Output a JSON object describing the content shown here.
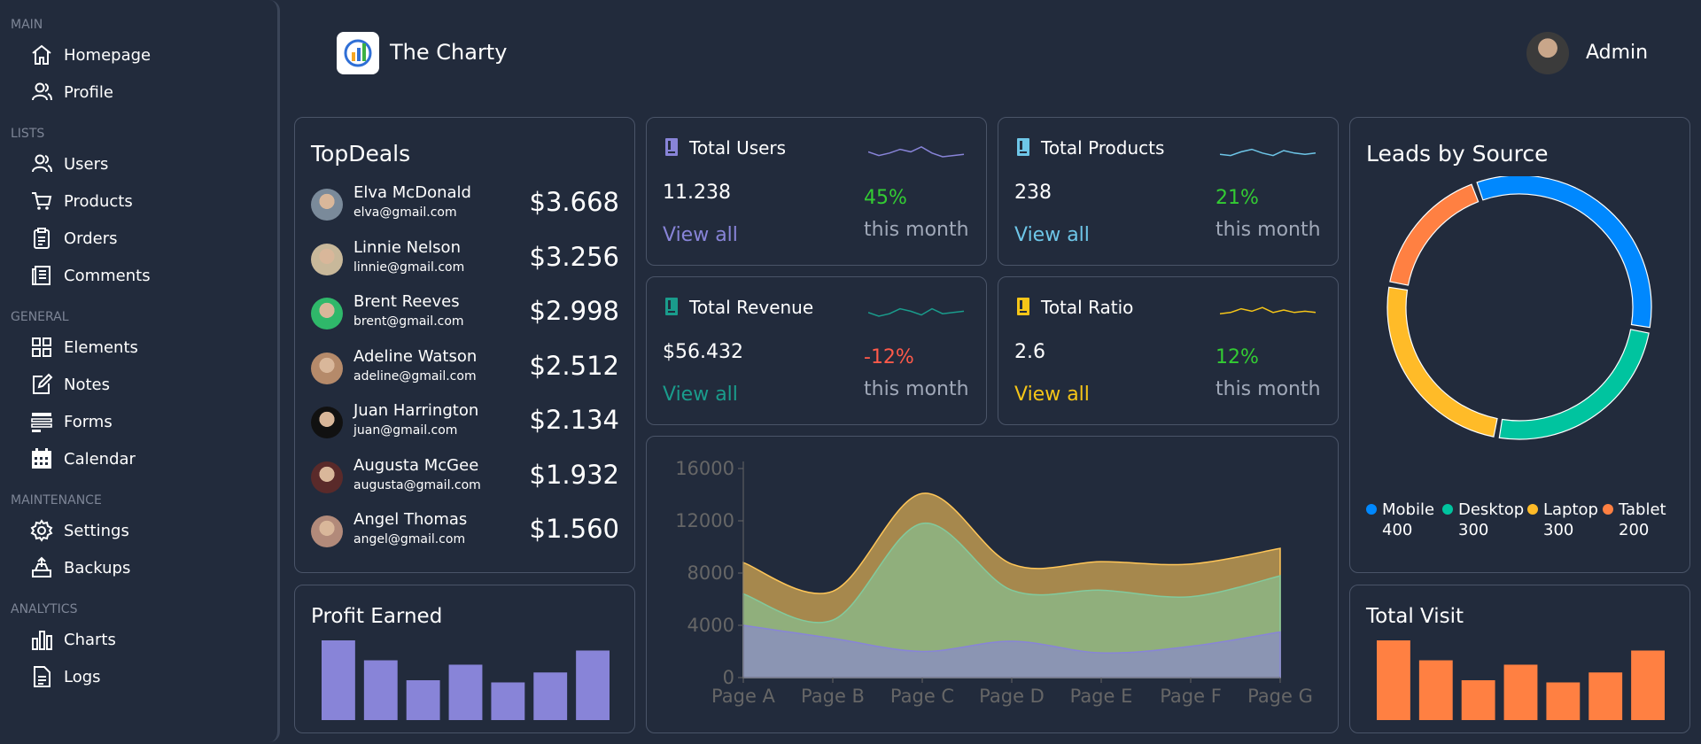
{
  "sidebar": {
    "sections": [
      {
        "title": "MAIN",
        "items": [
          {
            "label": "Homepage",
            "icon": "home-icon"
          },
          {
            "label": "Profile",
            "icon": "user-icon"
          }
        ]
      },
      {
        "title": "LISTS",
        "items": [
          {
            "label": "Users",
            "icon": "users-icon"
          },
          {
            "label": "Products",
            "icon": "cart-icon"
          },
          {
            "label": "Orders",
            "icon": "clipboard-icon"
          },
          {
            "label": "Comments",
            "icon": "comments-icon"
          }
        ]
      },
      {
        "title": "GENERAL",
        "items": [
          {
            "label": "Elements",
            "icon": "grid-icon"
          },
          {
            "label": "Notes",
            "icon": "note-icon"
          },
          {
            "label": "Forms",
            "icon": "form-icon"
          },
          {
            "label": "Calendar",
            "icon": "calendar-icon"
          }
        ]
      },
      {
        "title": "MAINTENANCE",
        "items": [
          {
            "label": "Settings",
            "icon": "gear-icon"
          },
          {
            "label": "Backups",
            "icon": "backup-icon"
          }
        ]
      },
      {
        "title": "ANALYTICS",
        "items": [
          {
            "label": "Charts",
            "icon": "chart-icon"
          },
          {
            "label": "Logs",
            "icon": "log-icon"
          }
        ]
      }
    ]
  },
  "header": {
    "app_title": "The Charty",
    "user_name": "Admin"
  },
  "top_deals": {
    "title": "TopDeals",
    "rows": [
      {
        "name": "Elva McDonald",
        "email": "elva@gmail.com",
        "amount": "$3.668"
      },
      {
        "name": "Linnie Nelson",
        "email": "linnie@gmail.com",
        "amount": "$3.256"
      },
      {
        "name": "Brent Reeves",
        "email": "brent@gmail.com",
        "amount": "$2.998"
      },
      {
        "name": "Adeline Watson",
        "email": "adeline@gmail.com",
        "amount": "$2.512"
      },
      {
        "name": "Juan Harrington",
        "email": "juan@gmail.com",
        "amount": "$2.134"
      },
      {
        "name": "Augusta McGee",
        "email": "augusta@gmail.com",
        "amount": "$1.932"
      },
      {
        "name": "Angel Thomas",
        "email": "angel@gmail.com",
        "amount": "$1.560"
      }
    ]
  },
  "stats": [
    {
      "title": "Total Users",
      "value": "11.238",
      "link": "View all",
      "percent": "45%",
      "period": "this month",
      "color": "#8884d8",
      "pct_color": "#33cc33"
    },
    {
      "title": "Total Products",
      "value": "238",
      "link": "View all",
      "percent": "21%",
      "period": "this month",
      "color": "#6ec6e8",
      "pct_color": "#33cc33"
    },
    {
      "title": "Total Revenue",
      "value": "$56.432",
      "link": "View all",
      "percent": "-12%",
      "period": "this month",
      "color": "#1a9c8c",
      "pct_color": "#ff5a4a"
    },
    {
      "title": "Total Ratio",
      "value": "2.6",
      "link": "View all",
      "percent": "12%",
      "period": "this month",
      "color": "#f5c518",
      "pct_color": "#33cc33"
    }
  ],
  "leads": {
    "title": "Leads by Source",
    "items": [
      {
        "name": "Mobile",
        "value": "400",
        "color": "#0088fe"
      },
      {
        "name": "Desktop",
        "value": "300",
        "color": "#00c49f"
      },
      {
        "name": "Laptop",
        "value": "300",
        "color": "#ffbb28"
      },
      {
        "name": "Tablet",
        "value": "200",
        "color": "#ff8042"
      }
    ]
  },
  "profit": {
    "title": "Profit Earned",
    "color": "#8884d8"
  },
  "visit": {
    "title": "Total Visit",
    "color": "#ff8042"
  },
  "chart_data": [
    {
      "type": "area",
      "title": "",
      "categories": [
        "Page A",
        "Page B",
        "Page C",
        "Page D",
        "Page E",
        "Page F",
        "Page G"
      ],
      "ylim": [
        0,
        16000
      ],
      "yticks": [
        "0",
        "4000",
        "8000",
        "12000",
        "16000"
      ],
      "stacked": true,
      "series": [
        {
          "values": [
            4000,
            3000,
            2000,
            2780,
            1890,
            2390,
            3490
          ],
          "color": "#8884d8"
        },
        {
          "values": [
            2400,
            1398,
            9800,
            3908,
            4800,
            3800,
            4300
          ],
          "color": "#82ca9d"
        },
        {
          "values": [
            2400,
            2210,
            2290,
            2000,
            2181,
            2500,
            2100
          ],
          "color": "#ffc658"
        }
      ]
    },
    {
      "type": "bar",
      "title": "Profit Earned",
      "values": [
        4000,
        3000,
        2000,
        2780,
        1890,
        2390,
        3490
      ],
      "ylim": [
        0,
        4000
      ]
    },
    {
      "type": "bar",
      "title": "Total Visit",
      "values": [
        4000,
        3000,
        2000,
        2780,
        1890,
        2390,
        3490
      ],
      "ylim": [
        0,
        4000
      ]
    },
    {
      "type": "pie",
      "title": "Leads by Source",
      "categories": [
        "Mobile",
        "Desktop",
        "Laptop",
        "Tablet"
      ],
      "values": [
        400,
        300,
        300,
        200
      ]
    }
  ]
}
